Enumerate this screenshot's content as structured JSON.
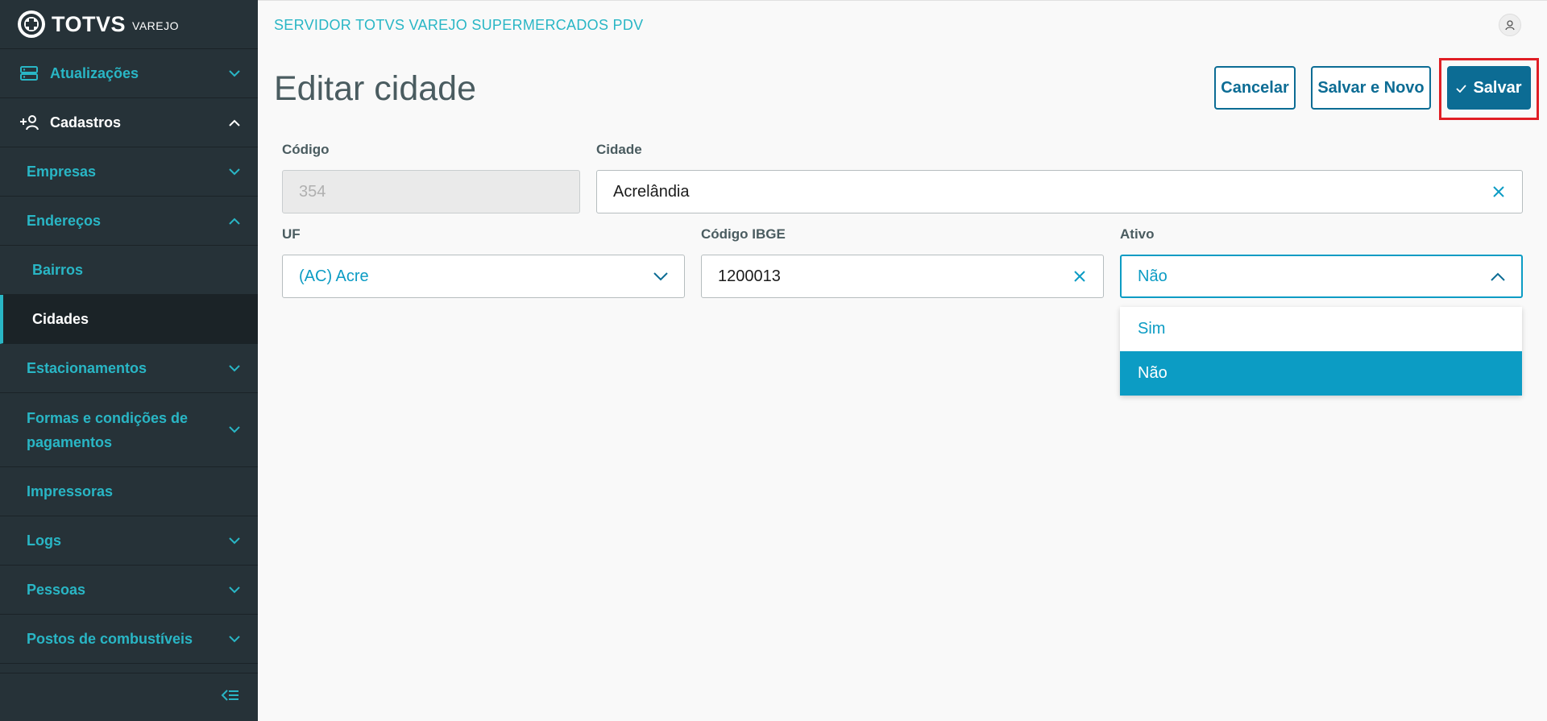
{
  "brand": {
    "name": "TOTVS",
    "sub": "VAREJO"
  },
  "header": {
    "app_title": "SERVIDOR TOTVS VAREJO SUPERMERCADOS PDV"
  },
  "sidebar": {
    "items": [
      {
        "label": "Atualizações"
      },
      {
        "label": "Cadastros"
      },
      {
        "label": "Empresas"
      },
      {
        "label": "Endereços"
      },
      {
        "label": "Bairros"
      },
      {
        "label": "Cidades"
      },
      {
        "label": "Estacionamentos"
      },
      {
        "label": "Formas e condições de pagamentos"
      },
      {
        "label": "Impressoras"
      },
      {
        "label": "Logs"
      },
      {
        "label": "Pessoas"
      },
      {
        "label": "Postos de combustíveis"
      }
    ]
  },
  "page": {
    "title": "Editar cidade",
    "buttons": {
      "cancel": "Cancelar",
      "save_new": "Salvar e Novo",
      "save": "Salvar"
    }
  },
  "form": {
    "codigo": {
      "label": "Código",
      "value": "354"
    },
    "cidade": {
      "label": "Cidade",
      "value": "Acrelândia"
    },
    "uf": {
      "label": "UF",
      "value": "(AC) Acre"
    },
    "ibge": {
      "label": "Código IBGE",
      "value": "1200013"
    },
    "ativo": {
      "label": "Ativo",
      "value": "Não",
      "options": [
        "Sim",
        "Não"
      ]
    }
  },
  "colors": {
    "sidebar_bg": "#263238",
    "accent": "#29b6c5",
    "primary": "#0c6c94",
    "select_highlight": "#0c9cc4",
    "focus_box": "#e01e25"
  }
}
